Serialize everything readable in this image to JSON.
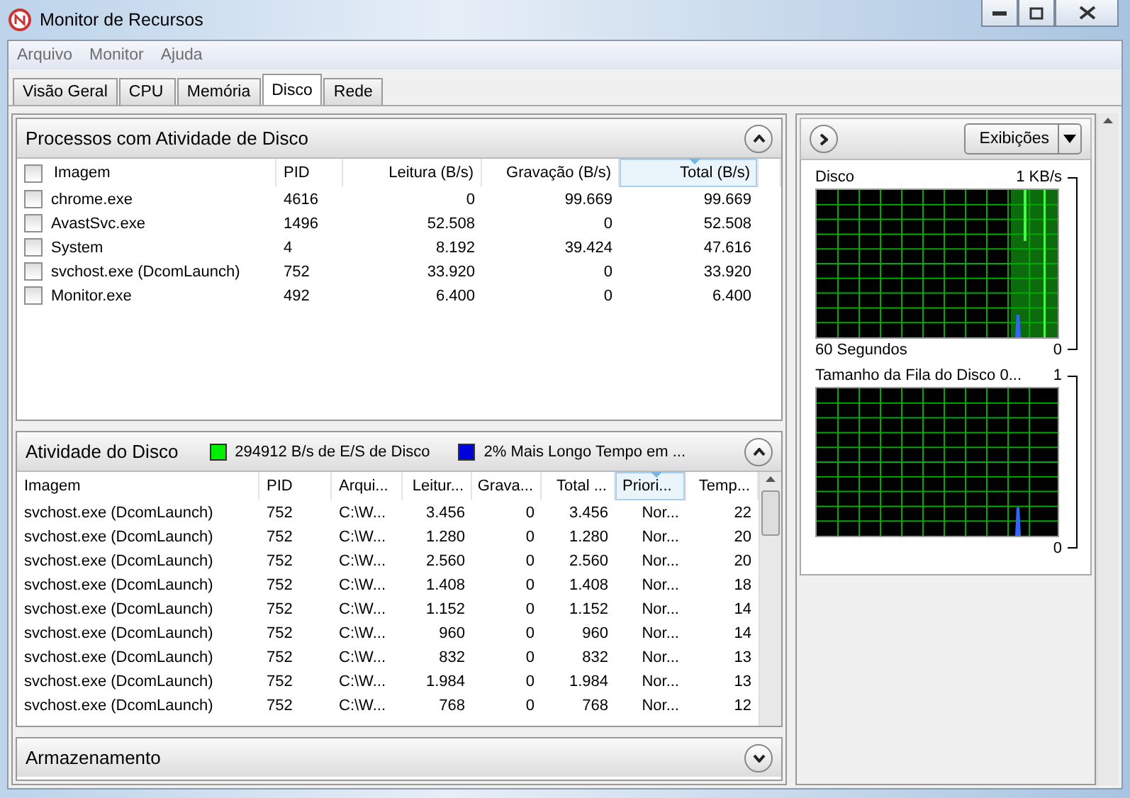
{
  "window": {
    "title": "Monitor de Recursos"
  },
  "menu": [
    "Arquivo",
    "Monitor",
    "Ajuda"
  ],
  "tabs": [
    {
      "label": "Visão Geral",
      "selected": false
    },
    {
      "label": "CPU",
      "selected": false
    },
    {
      "label": "Memória",
      "selected": false
    },
    {
      "label": "Disco",
      "selected": true
    },
    {
      "label": "Rede",
      "selected": false
    }
  ],
  "processes": {
    "title": "Processos com Atividade de Disco",
    "expanded": true,
    "columns": [
      {
        "label": "Imagem",
        "sorted": false
      },
      {
        "label": "PID",
        "sorted": false
      },
      {
        "label": "Leitura (B/s)",
        "sorted": false
      },
      {
        "label": "Gravação (B/s)",
        "sorted": false
      },
      {
        "label": "Total (B/s)",
        "sorted": true
      }
    ],
    "rows": [
      {
        "checked": false,
        "cells": [
          "chrome.exe",
          "4616",
          "0",
          "99.669",
          "99.669"
        ]
      },
      {
        "checked": false,
        "cells": [
          "AvastSvc.exe",
          "1496",
          "52.508",
          "0",
          "52.508"
        ]
      },
      {
        "checked": false,
        "cells": [
          "System",
          "4",
          "8.192",
          "39.424",
          "47.616"
        ]
      },
      {
        "checked": false,
        "cells": [
          "svchost.exe (DcomLaunch)",
          "752",
          "33.920",
          "0",
          "33.920"
        ]
      },
      {
        "checked": false,
        "cells": [
          "Monitor.exe",
          "492",
          "6.400",
          "0",
          "6.400"
        ]
      }
    ]
  },
  "activity": {
    "title": "Atividade do Disco",
    "expanded": true,
    "legend": [
      {
        "label": "294912 B/s de E/S de Disco",
        "color": "#00ee00"
      },
      {
        "label": "2% Mais Longo Tempo em ...",
        "color": "#0000dd"
      }
    ],
    "columns": [
      {
        "label": "Imagem",
        "sorted": false
      },
      {
        "label": "PID",
        "sorted": false
      },
      {
        "label": "Arqui...",
        "sorted": false
      },
      {
        "label": "Leitur...",
        "sorted": false
      },
      {
        "label": "Grava...",
        "sorted": false
      },
      {
        "label": "Total ...",
        "sorted": false
      },
      {
        "label": "Priori...",
        "sorted": true
      },
      {
        "label": "Temp...",
        "sorted": false
      }
    ],
    "rows": [
      [
        "svchost.exe (DcomLaunch)",
        "752",
        "C:\\W...",
        "3.456",
        "0",
        "3.456",
        "Nor...",
        "22"
      ],
      [
        "svchost.exe (DcomLaunch)",
        "752",
        "C:\\W...",
        "1.280",
        "0",
        "1.280",
        "Nor...",
        "20"
      ],
      [
        "svchost.exe (DcomLaunch)",
        "752",
        "C:\\W...",
        "2.560",
        "0",
        "2.560",
        "Nor...",
        "20"
      ],
      [
        "svchost.exe (DcomLaunch)",
        "752",
        "C:\\W...",
        "1.408",
        "0",
        "1.408",
        "Nor...",
        "18"
      ],
      [
        "svchost.exe (DcomLaunch)",
        "752",
        "C:\\W...",
        "1.152",
        "0",
        "1.152",
        "Nor...",
        "14"
      ],
      [
        "svchost.exe (DcomLaunch)",
        "752",
        "C:\\W...",
        "960",
        "0",
        "960",
        "Nor...",
        "14"
      ],
      [
        "svchost.exe (DcomLaunch)",
        "752",
        "C:\\W...",
        "832",
        "0",
        "832",
        "Nor...",
        "13"
      ],
      [
        "svchost.exe (DcomLaunch)",
        "752",
        "C:\\W...",
        "1.984",
        "0",
        "1.984",
        "Nor...",
        "13"
      ],
      [
        "svchost.exe (DcomLaunch)",
        "752",
        "C:\\W...",
        "768",
        "0",
        "768",
        "Nor...",
        "12"
      ]
    ]
  },
  "storage": {
    "title": "Armazenamento",
    "expanded": false
  },
  "side": {
    "views_button": "Exibições",
    "graphs": [
      {
        "title": "Disco",
        "max": "1 KB/s",
        "footer": "60 Segundos",
        "min": "0",
        "kind": "disk"
      },
      {
        "title": "Tamanho da Fila do Disco 0...",
        "max": "1",
        "min": "0",
        "kind": "queue"
      }
    ]
  }
}
